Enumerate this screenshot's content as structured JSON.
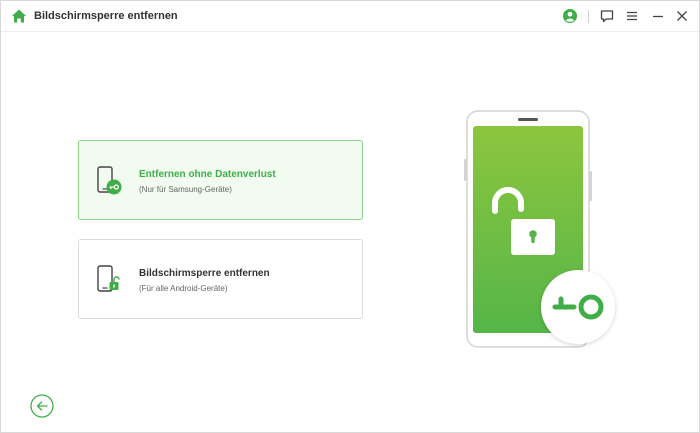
{
  "window": {
    "title": "Bildschirmsperre entfernen"
  },
  "titlebar_icons": [
    "home-icon",
    "account-icon",
    "feedback-icon",
    "menu-icon",
    "minimize-icon",
    "close-icon"
  ],
  "colors": {
    "accent": "#3fae49",
    "accent_light": "#8ccc3c",
    "selected_bg": "#f1fbf0",
    "selected_border": "#8fd48c"
  },
  "options": [
    {
      "title": "Entfernen ohne Datenverlust",
      "subtitle": "(Nur für Samsung-Geräte)",
      "icon": "phone-key-icon",
      "selected": true
    },
    {
      "title": "Bildschirmsperre entfernen",
      "subtitle": "(Für alle Android-Geräte)",
      "icon": "phone-unlock-icon",
      "selected": false
    }
  ],
  "illustration": {
    "icons": [
      "phone-illustration",
      "open-padlock-icon",
      "key-icon"
    ]
  },
  "navigation": {
    "back_icon": "arrow-left-icon"
  }
}
